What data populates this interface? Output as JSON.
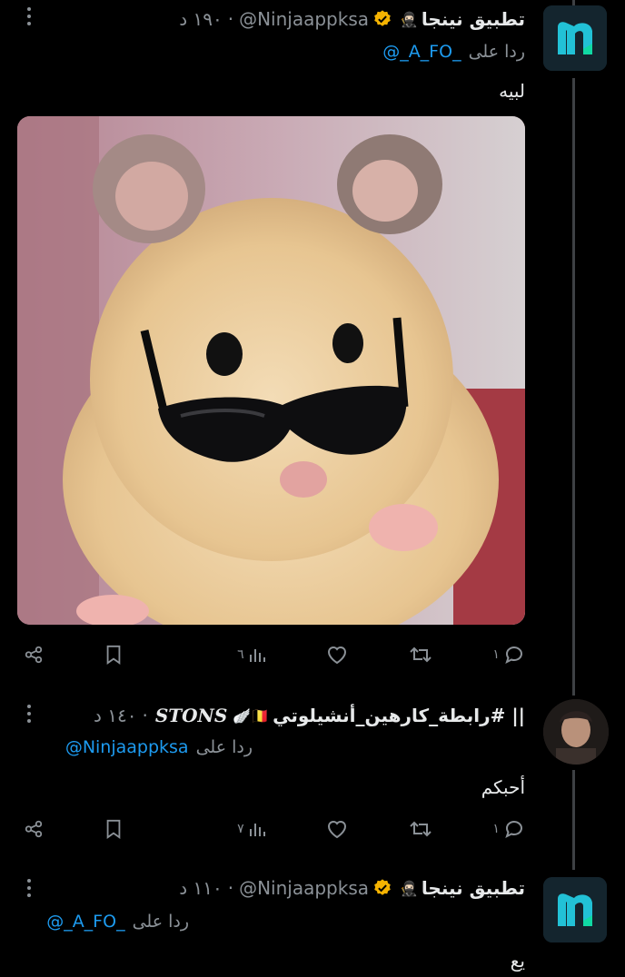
{
  "tweets": [
    {
      "name": "تطبيق نينجا",
      "name_emoji": "🥷🏻",
      "handle": "@Ninjaappksa",
      "time": "١٩٠ د",
      "reply_label": "ردا على",
      "reply_handle": "@_A_FO_",
      "text": "لبيه",
      "actions": {
        "replies": "١",
        "retweets": "",
        "likes": "",
        "views": "٦"
      }
    },
    {
      "name": "رابطة_كارهين_أنشيلوتي# ||",
      "name_emoji": "🪽🇧🇪",
      "name_extra": "STONS",
      "time": "١٤٠ د",
      "reply_label": "ردا على",
      "reply_handle": "@Ninjaappksa",
      "text": "أحبكم",
      "actions": {
        "replies": "١",
        "retweets": "",
        "likes": "",
        "views": "٧"
      }
    },
    {
      "name": "تطبيق نينجا",
      "name_emoji": "🥷🏻",
      "handle": "@Ninjaappksa",
      "time": "١١٠ د",
      "reply_label": "ردا على",
      "reply_handle": "@_A_FO_",
      "text": "يع"
    }
  ],
  "ui": {
    "separator": "·",
    "avatar_letter": "n"
  },
  "icons": [
    "more-vertical-icon",
    "verified-badge-icon",
    "reply-icon",
    "retweet-icon",
    "like-icon",
    "views-icon",
    "bookmark-icon",
    "share-icon"
  ],
  "colors": {
    "background": "#000000",
    "text": "#e7e9ea",
    "muted": "#8b9197",
    "link": "#1d9bf0",
    "verified": "#f5b301",
    "brand": "#22c1d6"
  }
}
